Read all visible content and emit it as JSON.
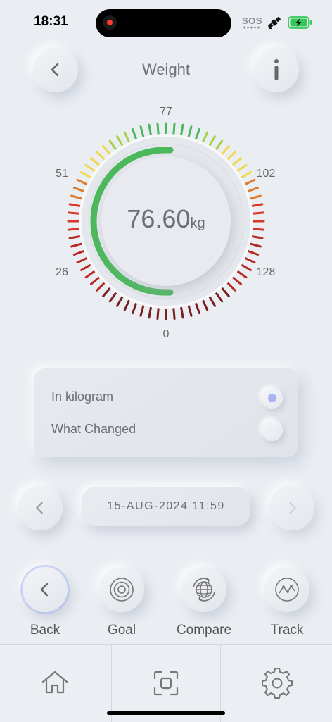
{
  "status_bar": {
    "time": "18:31",
    "sos": "SOS",
    "icons": [
      "satellite-icon",
      "battery-charging-icon"
    ],
    "battery_color": "#34c759"
  },
  "header": {
    "title": "Weight",
    "back_icon": "chevron-left-icon",
    "info_icon": "info-icon"
  },
  "gauge": {
    "scale_labels": {
      "top": "77",
      "upper_left": "51",
      "upper_right": "102",
      "lower_left": "26",
      "lower_right": "128",
      "bottom": "0"
    },
    "value": "76.60",
    "unit": "kg",
    "progress_fraction": 0.5,
    "progress_color": "#4cb85c",
    "tick_colors": [
      "#7a1f1f",
      "#b52a22",
      "#d8362a",
      "#e07a2a",
      "#f0d84a",
      "#a6d24a",
      "#4cb85c"
    ]
  },
  "options": {
    "items": [
      {
        "label": "In kilogram",
        "selected": true
      },
      {
        "label": "What Changed",
        "selected": false
      }
    ],
    "selected_color": "#a8b3f0"
  },
  "date_nav": {
    "prev_icon": "chevron-left-icon",
    "next_icon": "chevron-right-icon",
    "date": "15-AUG-2024 11:59"
  },
  "actions": [
    {
      "label": "Back",
      "icon": "chevron-left-icon"
    },
    {
      "label": "Goal",
      "icon": "target-icon"
    },
    {
      "label": "Compare",
      "icon": "globe-sync-icon"
    },
    {
      "label": "Track",
      "icon": "trend-chart-icon"
    }
  ],
  "tab_bar": [
    {
      "icon": "home-icon"
    },
    {
      "icon": "scan-icon"
    },
    {
      "icon": "settings-gear-icon"
    }
  ]
}
